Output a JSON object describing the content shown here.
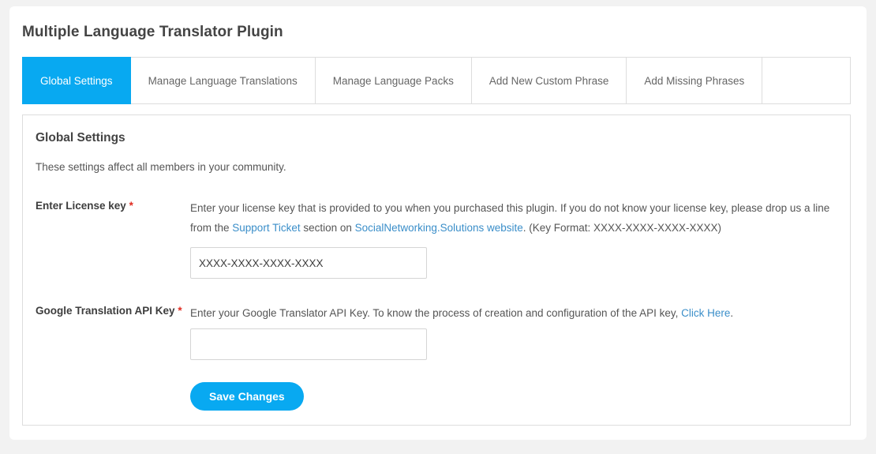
{
  "page": {
    "title": "Multiple Language Translator Plugin"
  },
  "tabs": [
    {
      "label": "Global Settings",
      "active": true
    },
    {
      "label": "Manage Language Translations",
      "active": false
    },
    {
      "label": "Manage Language Packs",
      "active": false
    },
    {
      "label": "Add New Custom Phrase",
      "active": false
    },
    {
      "label": "Add Missing Phrases",
      "active": false
    }
  ],
  "panel": {
    "title": "Global Settings",
    "subtitle": "These settings affect all members in your community."
  },
  "form": {
    "license": {
      "label": "Enter License key",
      "required_marker": "*",
      "desc_part1": "Enter your license key that is provided to you when you purchased this plugin. If you do not know your license key, please drop us a line from the ",
      "link_support": "Support Ticket",
      "desc_part2": " section on ",
      "link_site": "SocialNetworking.Solutions website",
      "desc_part3": ". (Key Format: XXXX-XXXX-XXXX-XXXX)",
      "input_value": "XXXX-XXXX-XXXX-XXXX",
      "input_placeholder": "XXXX-XXXX-XXXX-XXXX"
    },
    "apikey": {
      "label": "Google Translation API Key",
      "required_marker": "*",
      "desc_part1": "Enter your Google Translator API Key. To know the process of creation and configuration of the API key, ",
      "link_clickhere": "Click Here",
      "desc_part2": ".",
      "input_value": "",
      "input_placeholder": ""
    },
    "save_label": "Save Changes"
  },
  "colors": {
    "accent": "#08a9f1",
    "link": "#3a8ec9",
    "required": "#e02b20",
    "page_bg": "#f2f2f2",
    "border": "#dddddd"
  }
}
